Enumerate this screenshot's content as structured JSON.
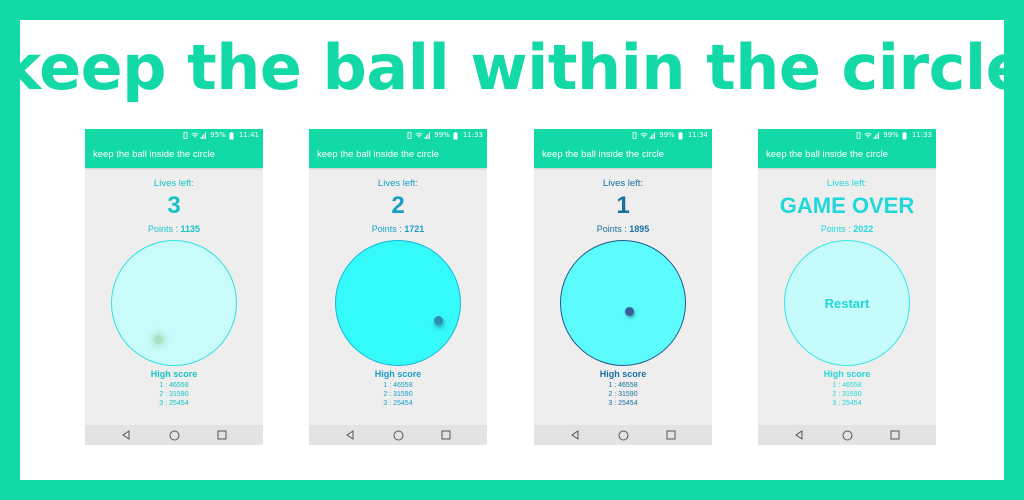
{
  "headline": "keep the ball within the circle.",
  "colors": {
    "brand": "#13d9a6",
    "white": "#ffffff"
  },
  "phones": [
    {
      "status_battery": "95%",
      "status_time": "11:41",
      "app_title": "keep the ball inside the circle",
      "lives_label": "Lives left:",
      "lives_value": "3",
      "points_label": "Points : ",
      "points_value": "1135",
      "high_score_title": "High score",
      "high_scores": [
        "1 : 46558",
        "2 : 31590",
        "3 : 25454"
      ],
      "accent": "#17c4c4",
      "text_color": "#17c4c4",
      "circle_fill": "#c9fbfb",
      "circle_border": "#2fe0e0",
      "ball_color": "#a6e3c4"
    },
    {
      "status_battery": "99%",
      "status_time": "11:33",
      "app_title": "keep the ball inside the circle",
      "lives_label": "Lives left:",
      "lives_value": "2",
      "points_label": "Points : ",
      "points_value": "1721",
      "high_score_title": "High score",
      "high_scores": [
        "1 : 46558",
        "2 : 31590",
        "3 : 25454"
      ],
      "accent": "#1a9fc8",
      "text_color": "#1a9fc8",
      "circle_fill": "#34fafa",
      "circle_border": "#19b8d8",
      "ball_color": "#2e8fb0"
    },
    {
      "status_battery": "99%",
      "status_time": "11:34",
      "app_title": "keep the ball inside the circle",
      "lives_label": "Lives left:",
      "lives_value": "1",
      "points_label": "Points : ",
      "points_value": "1895",
      "high_score_title": "High score",
      "high_scores": [
        "1 : 46558",
        "2 : 31590",
        "3 : 25454"
      ],
      "accent": "#1a6f9e",
      "text_color": "#1a6f9e",
      "circle_fill": "#5dfcfc",
      "circle_border": "#1f5a8e",
      "ball_color": "#3a5e9a"
    },
    {
      "status_battery": "99%",
      "status_time": "11:33",
      "app_title": "keep the ball inside the circle",
      "lives_label": "Lives left:",
      "lives_value": "GAME OVER",
      "points_label": "Points : ",
      "points_value": "2022",
      "restart_label": "Restart",
      "high_score_title": "High score",
      "high_scores": [
        "1 : 46558",
        "2 : 31590",
        "3 : 25454"
      ],
      "accent": "#21d8d8",
      "text_color": "#21d8d8",
      "circle_fill": "#c6fbfb",
      "circle_border": "#35e6e6",
      "ball_color": ""
    }
  ],
  "nav_icons": [
    "back-icon",
    "home-icon",
    "recents-icon"
  ]
}
